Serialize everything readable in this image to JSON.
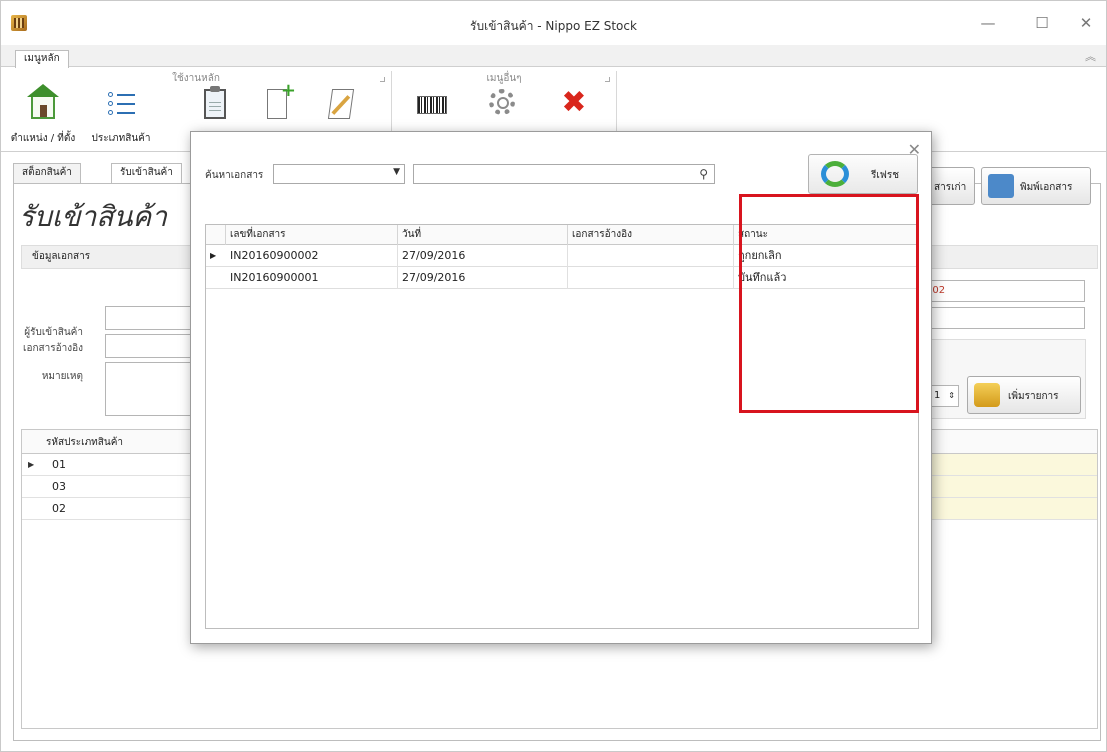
{
  "window": {
    "title": "รับเข้าสินค้า - Nippo EZ Stock",
    "controls": [
      "—",
      "☐",
      "✕"
    ]
  },
  "ribbon": {
    "tab": "เมนูหลัก",
    "collapse_glyph": "︽",
    "groups": [
      {
        "caption": "ใช้งานหลัก",
        "items": [
          {
            "label": "ตำแหน่ง / ที่ตั้ง",
            "icon": "home-icon"
          },
          {
            "label": "ประเภทสินค้า",
            "icon": "list-icon"
          },
          {
            "label": "",
            "icon": "clipboard-icon"
          },
          {
            "label": "",
            "icon": "new-document-icon"
          },
          {
            "label": "",
            "icon": "edit-document-icon"
          }
        ]
      },
      {
        "caption": "เมนูอื่นๆ",
        "items": [
          {
            "label": "",
            "icon": "barcode-icon"
          },
          {
            "label": "",
            "icon": "gear-icon"
          },
          {
            "label": "",
            "icon": "close-red-icon"
          }
        ]
      }
    ]
  },
  "doc_tabs": [
    "สต็อกสินค้า",
    "รับเข้าสินค้า"
  ],
  "page": {
    "title": "รับเข้าสินค้า",
    "section_header": "ข้อมูลเอกสาร",
    "fields": {
      "receiver_label": "ผู้รับเข้าสินค้า",
      "reference_label": "เอกสารอ้างอิง",
      "note_label": "หมายเหตุ"
    },
    "doc_number_partial": "002",
    "buttons": {
      "old_docs": "สารเก่า",
      "print": "พิมพ์เอกสาร",
      "add_item": "เพิ่มรายการ"
    },
    "quantity": "1",
    "grid": {
      "header": "รหัสประเภทสินค้า",
      "rows": [
        "01",
        "03",
        "02"
      ]
    }
  },
  "modal": {
    "search_label": "ค้นหาเอกสาร",
    "combo_value": "",
    "search_value": "",
    "refresh_label": "รีเฟรช",
    "columns": [
      "เลขที่เอกสาร",
      "วันที่",
      "เอกสารอ้างอิง",
      "สถานะ"
    ],
    "rows": [
      {
        "doc_no": "IN20160900002",
        "date": "27/09/2016",
        "ref": "",
        "status": "ถูกยกเลิก"
      },
      {
        "doc_no": "IN20160900001",
        "date": "27/09/2016",
        "ref": "",
        "status": "บันทึกแล้ว"
      }
    ]
  },
  "colors": {
    "highlight": "#d8141e",
    "row_highlight": "#fbf8dc",
    "doc_number_color": "#c0392b"
  }
}
